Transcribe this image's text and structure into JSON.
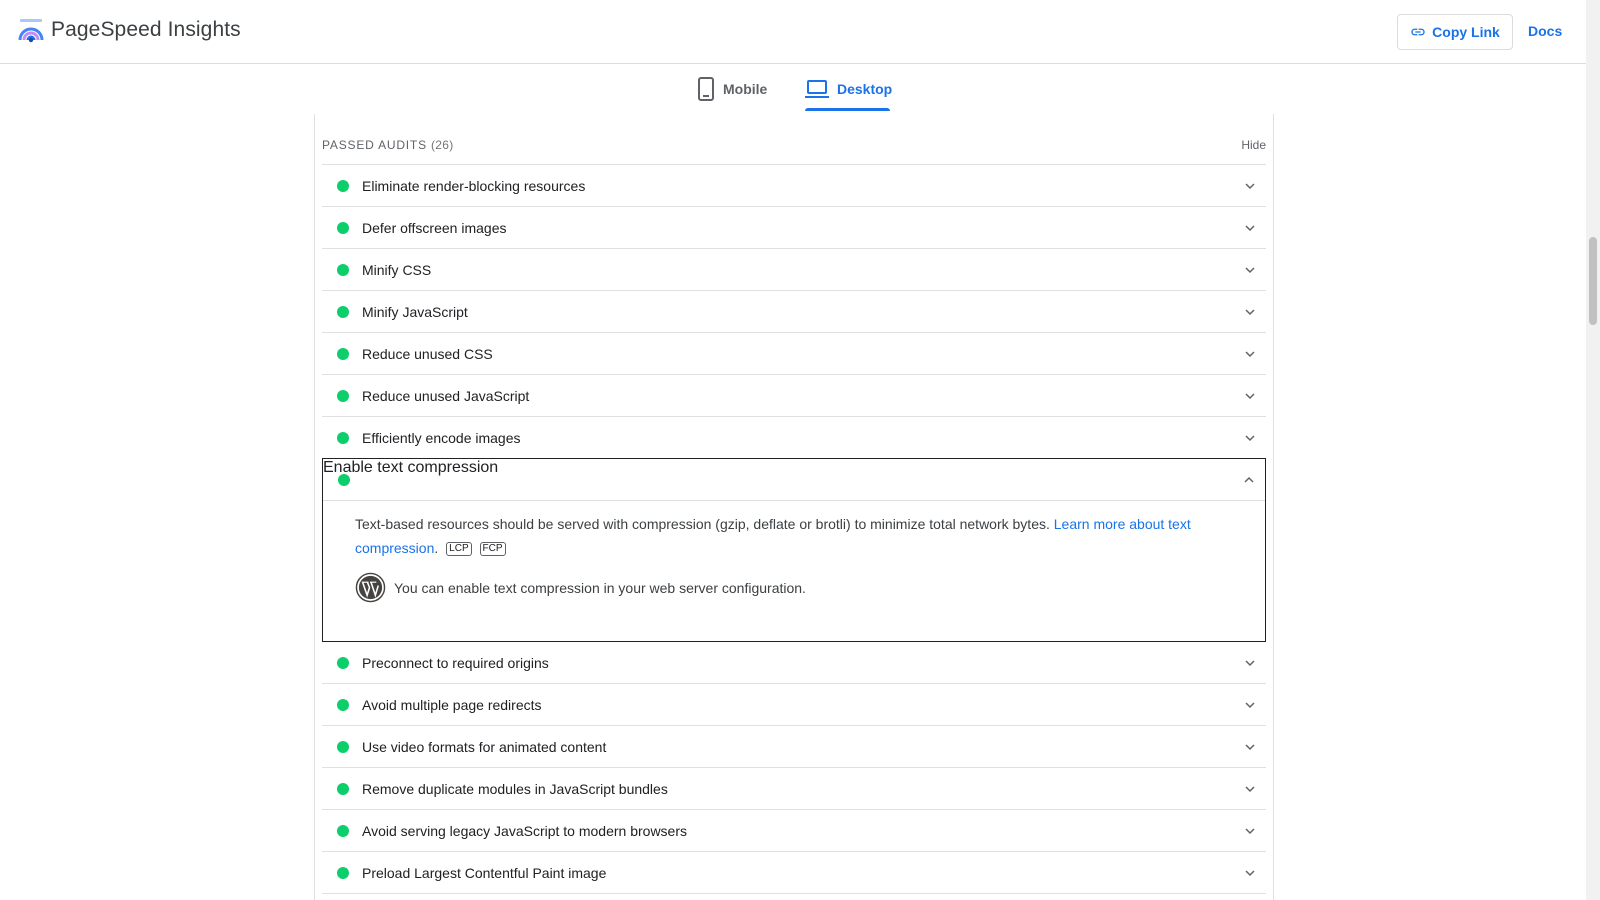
{
  "header": {
    "brand": "PageSpeed Insights",
    "copy_link_label": "Copy Link",
    "docs_label": "Docs"
  },
  "tabs": [
    {
      "label": "Mobile",
      "icon": "smartphone-icon",
      "active": false
    },
    {
      "label": "Desktop",
      "icon": "laptop-icon",
      "active": true
    }
  ],
  "passed_audits": {
    "title": "PASSED AUDITS",
    "count": "(26)",
    "hide_label": "Hide",
    "items_before": [
      "Eliminate render-blocking resources",
      "Defer offscreen images",
      "Minify CSS",
      "Minify JavaScript",
      "Reduce unused CSS",
      "Reduce unused JavaScript",
      "Efficiently encode images"
    ],
    "expanded": {
      "title": "Enable text compression",
      "description": "Text-based resources should be served with compression (gzip, deflate or brotli) to minimize total network bytes.",
      "learn_more": "Learn more about text compression",
      "tags": [
        "LCP",
        "FCP"
      ],
      "hint": "You can enable text compression in your web server configuration.",
      "hint_icon": "wordpress-icon"
    },
    "items_after": [
      "Preconnect to required origins",
      "Avoid multiple page redirects",
      "Use video formats for animated content",
      "Remove duplicate modules in JavaScript bundles",
      "Avoid serving legacy JavaScript to modern browsers",
      "Preload Largest Contentful Paint image"
    ]
  },
  "colors": {
    "accent": "#1a73e8",
    "pass": "#0cce6b"
  }
}
